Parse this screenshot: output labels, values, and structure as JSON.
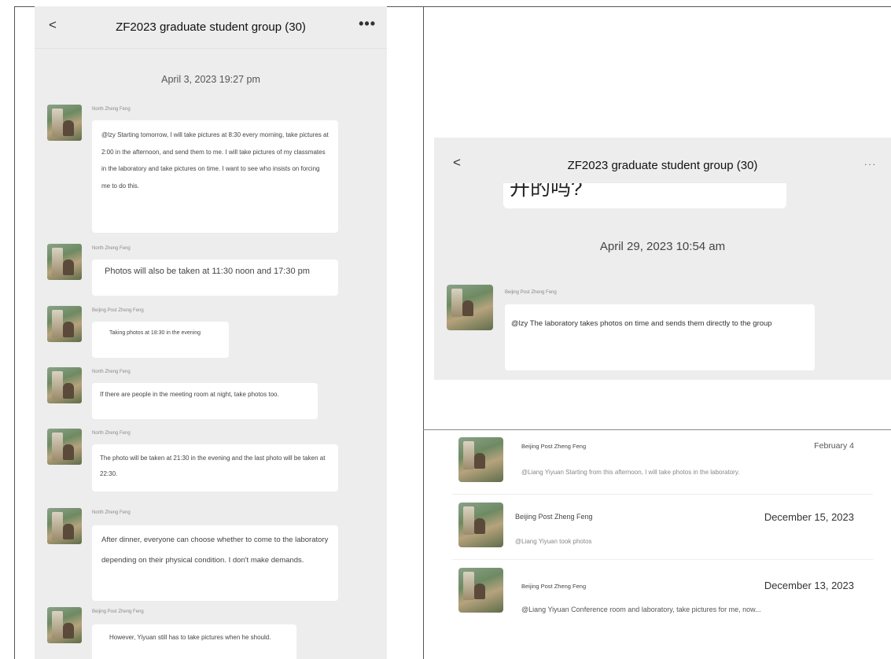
{
  "left_chat": {
    "back_label": "<",
    "title": "ZF2023 graduate student group (30)",
    "more_label": "•••",
    "timestamp": "April 3, 2023 19:27 pm",
    "messages": [
      {
        "sender": "North Zheng Feng",
        "text": "@lzy Starting tomorrow, I will take pictures at 8:30 every morning, take pictures at 2:00 in the afternoon, and send them to me. I will take pictures of my classmates in the laboratory and take pictures on time. I want to see who insists on forcing me to do this."
      },
      {
        "sender": "North Zheng Feng",
        "text": "Photos will also be taken at 11:30 noon and 17:30 pm"
      },
      {
        "sender": "Beijing Post Zheng Feng",
        "text": "Taking photos at 18:30 in the evening"
      },
      {
        "sender": "North Zheng Feng",
        "text": "If there are people in the meeting room at night, take photos too."
      },
      {
        "sender": "North Zheng Feng",
        "text": "The photo will be taken at 21:30 in the evening and the last photo will be taken at 22:30."
      },
      {
        "sender": "North Zheng Feng",
        "text": "After dinner, everyone can choose whether to come to the laboratory depending on their physical condition. I don't make demands."
      },
      {
        "sender": "Beijing Post Zheng Feng",
        "text": "However, Yiyuan still has to take pictures when he should."
      }
    ]
  },
  "right_chat": {
    "back_label": "<",
    "title": "ZF2023 graduate student group (30)",
    "more_label": "...",
    "prev_fragment": "开的吗?",
    "timestamp": "April 29, 2023 10:54 am",
    "message": {
      "sender": "Beijing Post Zheng Feng",
      "text": "@lzy The laboratory takes photos on time and sends them directly to the group"
    }
  },
  "search_results": [
    {
      "name": "Beijing Post Zheng Feng",
      "date": "February 4",
      "preview": "@Liang Yiyuan Starting from this afternoon, I will take photos in the laboratory."
    },
    {
      "name": "Beijing Post Zheng Feng",
      "date": "December 15, 2023",
      "preview": "@Liang Yiyuan took photos"
    },
    {
      "name": "Beijing Post Zheng Feng",
      "date": "December 13, 2023",
      "preview": "@Liang Yiyuan Conference room and laboratory, take pictures for me, now..."
    }
  ]
}
